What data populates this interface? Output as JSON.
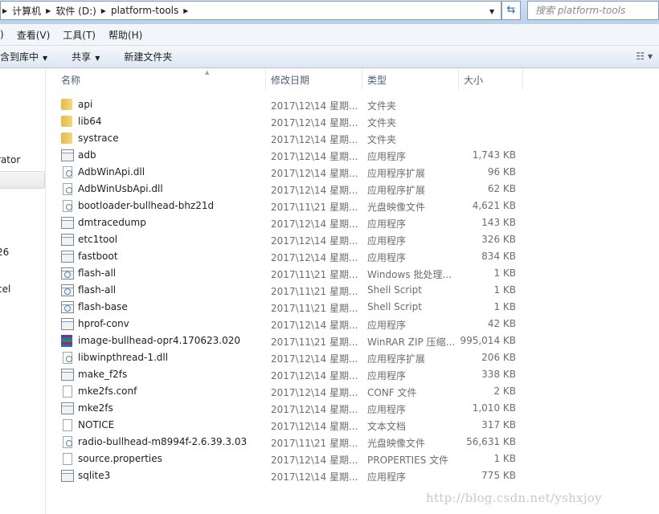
{
  "address": {
    "crumbs": [
      "计算机",
      "软件 (D:)",
      "platform-tools"
    ],
    "search_placeholder": "搜索 platform-tools"
  },
  "menubar": {
    "items": [
      ")",
      "查看(V)",
      "工具(T)",
      "帮助(H)"
    ]
  },
  "toolbar": {
    "include_library": "含到库中",
    "share": "共享",
    "new_folder": "新建文件夹"
  },
  "nav": {
    "items": [
      "rator",
      "26",
      "cel"
    ]
  },
  "columns": {
    "name": "名称",
    "date": "修改日期",
    "type": "类型",
    "size": "大小"
  },
  "files": [
    {
      "name": "api",
      "date": "2017\\12\\14 星期...",
      "type": "文件夹",
      "size": "",
      "icon": "folder"
    },
    {
      "name": "lib64",
      "date": "2017\\12\\14 星期...",
      "type": "文件夹",
      "size": "",
      "icon": "folder"
    },
    {
      "name": "systrace",
      "date": "2017\\12\\14 星期...",
      "type": "文件夹",
      "size": "",
      "icon": "folder"
    },
    {
      "name": "adb",
      "date": "2017\\12\\14 星期...",
      "type": "应用程序",
      "size": "1,743 KB",
      "icon": "app"
    },
    {
      "name": "AdbWinApi.dll",
      "date": "2017\\12\\14 星期...",
      "type": "应用程序扩展",
      "size": "96 KB",
      "icon": "dll"
    },
    {
      "name": "AdbWinUsbApi.dll",
      "date": "2017\\12\\14 星期...",
      "type": "应用程序扩展",
      "size": "62 KB",
      "icon": "dll"
    },
    {
      "name": "bootloader-bullhead-bhz21d",
      "date": "2017\\11\\21 星期...",
      "type": "光盘映像文件",
      "size": "4,621 KB",
      "icon": "img"
    },
    {
      "name": "dmtracedump",
      "date": "2017\\12\\14 星期...",
      "type": "应用程序",
      "size": "143 KB",
      "icon": "app"
    },
    {
      "name": "etc1tool",
      "date": "2017\\12\\14 星期...",
      "type": "应用程序",
      "size": "326 KB",
      "icon": "app"
    },
    {
      "name": "fastboot",
      "date": "2017\\12\\14 星期...",
      "type": "应用程序",
      "size": "834 KB",
      "icon": "app"
    },
    {
      "name": "flash-all",
      "date": "2017\\11\\21 星期...",
      "type": "Windows 批处理...",
      "size": "1 KB",
      "icon": "bat"
    },
    {
      "name": "flash-all",
      "date": "2017\\11\\21 星期...",
      "type": "Shell Script",
      "size": "1 KB",
      "icon": "bat"
    },
    {
      "name": "flash-base",
      "date": "2017\\11\\21 星期...",
      "type": "Shell Script",
      "size": "1 KB",
      "icon": "bat"
    },
    {
      "name": "hprof-conv",
      "date": "2017\\12\\14 星期...",
      "type": "应用程序",
      "size": "42 KB",
      "icon": "app"
    },
    {
      "name": "image-bullhead-opr4.170623.020",
      "date": "2017\\11\\21 星期...",
      "type": "WinRAR ZIP 压缩...",
      "size": "995,014 KB",
      "icon": "rar"
    },
    {
      "name": "libwinpthread-1.dll",
      "date": "2017\\12\\14 星期...",
      "type": "应用程序扩展",
      "size": "206 KB",
      "icon": "dll"
    },
    {
      "name": "make_f2fs",
      "date": "2017\\12\\14 星期...",
      "type": "应用程序",
      "size": "338 KB",
      "icon": "app"
    },
    {
      "name": "mke2fs.conf",
      "date": "2017\\12\\14 星期...",
      "type": "CONF 文件",
      "size": "2 KB",
      "icon": "doc"
    },
    {
      "name": "mke2fs",
      "date": "2017\\12\\14 星期...",
      "type": "应用程序",
      "size": "1,010 KB",
      "icon": "app"
    },
    {
      "name": "NOTICE",
      "date": "2017\\12\\14 星期...",
      "type": "文本文档",
      "size": "317 KB",
      "icon": "doc"
    },
    {
      "name": "radio-bullhead-m8994f-2.6.39.3.03",
      "date": "2017\\11\\21 星期...",
      "type": "光盘映像文件",
      "size": "56,631 KB",
      "icon": "img"
    },
    {
      "name": "source.properties",
      "date": "2017\\12\\14 星期...",
      "type": "PROPERTIES 文件",
      "size": "1 KB",
      "icon": "doc"
    },
    {
      "name": "sqlite3",
      "date": "2017\\12\\14 星期...",
      "type": "应用程序",
      "size": "775 KB",
      "icon": "app"
    }
  ],
  "watermark": "http://blog.csdn.net/yshxjoy"
}
